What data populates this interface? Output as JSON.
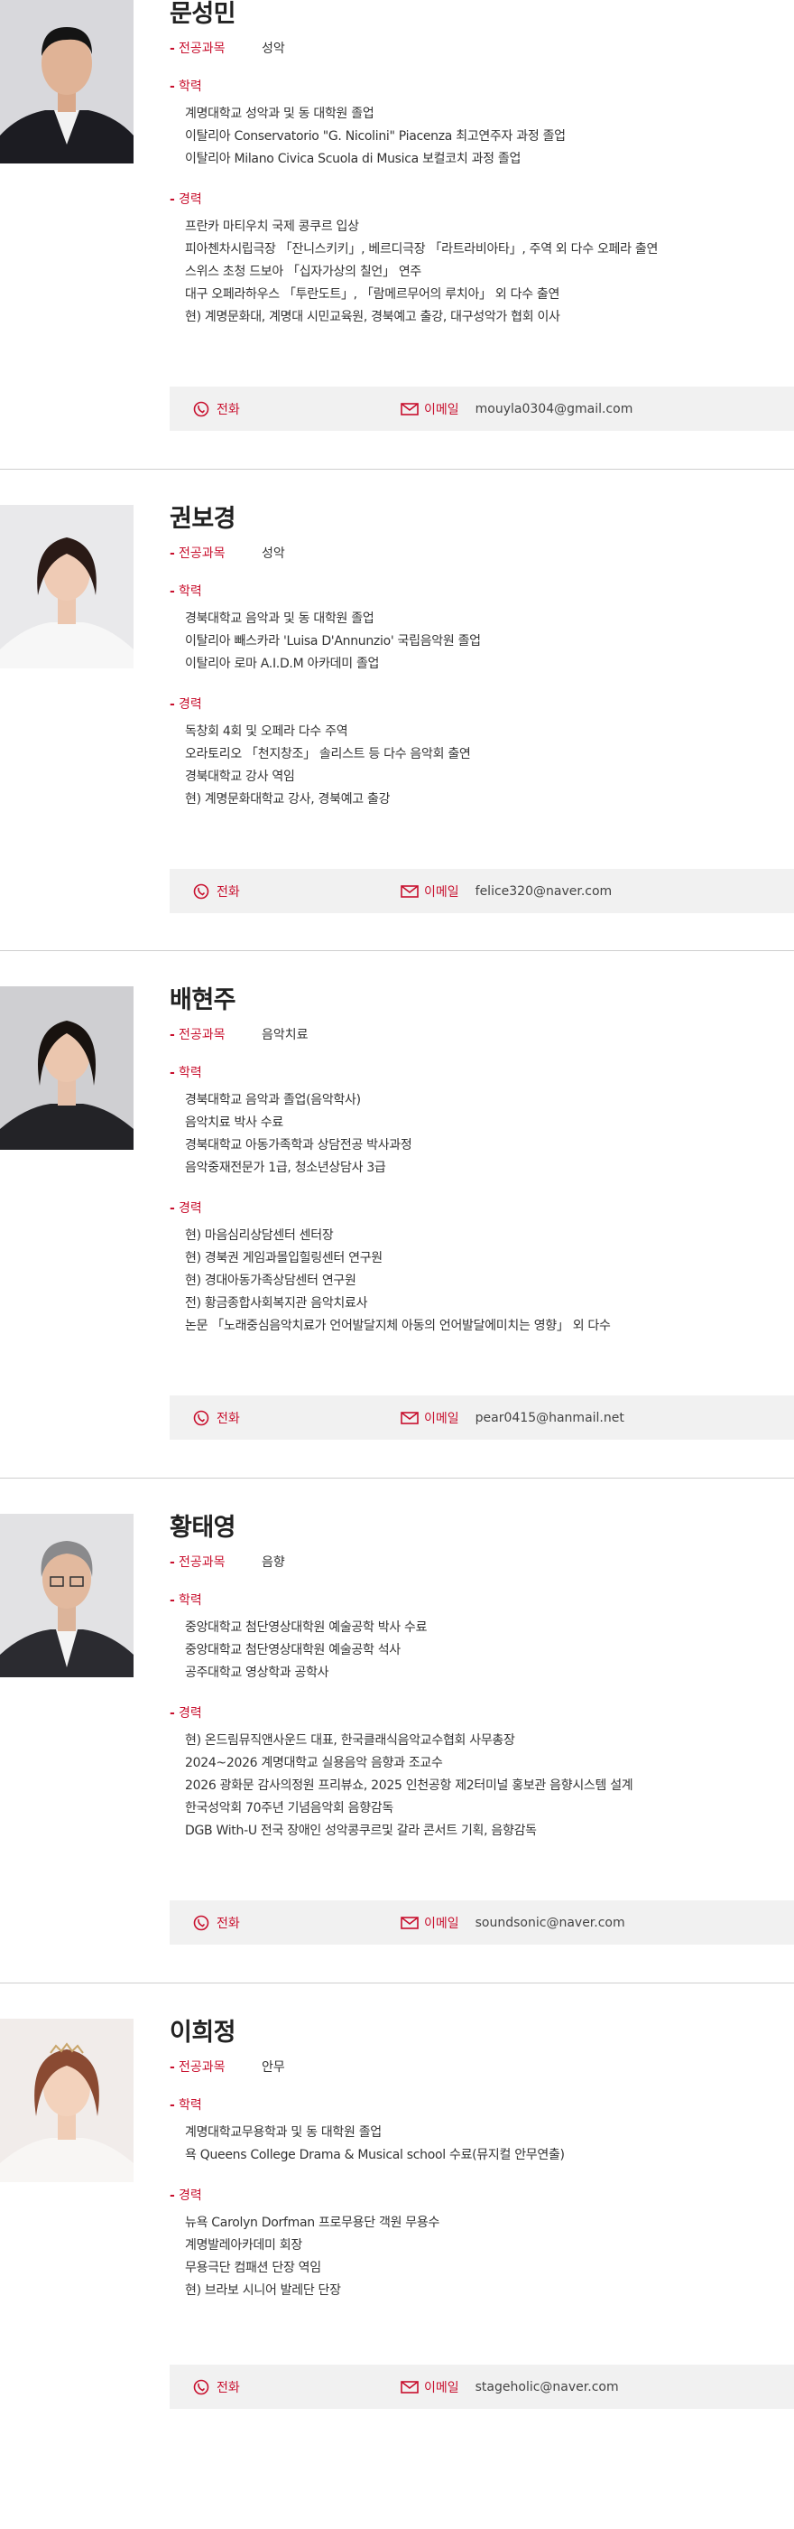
{
  "labels": {
    "major": "전공과목",
    "education": "학력",
    "career": "경력",
    "phone": "전화",
    "email": "이메일"
  },
  "profiles": [
    {
      "name": "문성민",
      "major": "성악",
      "education": [
        "계명대학교 성악과 및 동 대학원 졸업",
        "이탈리아 Conservatorio \"G. Nicolini\" Piacenza 최고연주자 과정 졸업",
        "이탈리아 Milano Civica Scuola di Musica 보컬코치 과정 졸업"
      ],
      "career": [
        "프란카 마티우치 국제 콩쿠르 입상",
        "피아첸차시립극장 「잔니스키키」, 베르디극장 「라트라비아타」, 주역 외 다수 오페라 출연",
        "스위스 초청 드보아 「십자가상의 칠언」 연주",
        "대구 오페라하우스 「투란도트」, 「람메르무어의 루치아」 외 다수 출연",
        "현) 계명문화대, 계명대 시민교육원, 경북예고 출강, 대구성악가 협회 이사"
      ],
      "email": "mouyla0304@gmail.com"
    },
    {
      "name": "권보경",
      "major": "성악",
      "education": [
        "경북대학교 음악과 및 동 대학원 졸업",
        "이탈리아 빼스카라 'Luisa D'Annunzio' 국립음악원 졸업",
        "이탈리아 로마 A.I.D.M 아카데미 졸업"
      ],
      "career": [
        "독창회 4회 및 오페라 다수 주역",
        "오라토리오 「천지창조」 솔리스트 등 다수 음악회 출연",
        "경북대학교 강사 역임",
        "현) 계명문화대학교 강사, 경북예고 출강"
      ],
      "email": "felice320@naver.com"
    },
    {
      "name": "배현주",
      "major": "음악치료",
      "education": [
        "경북대학교 음악과 졸업(음악학사)",
        "음악치료 박사 수료",
        "경북대학교 아동가족학과 상담전공 박사과정",
        "음악중재전문가 1급, 청소년상담사 3급"
      ],
      "career": [
        "현) 마음심리상담센터 센터장",
        "현) 경북권 게임과몰입힐링센터 연구원",
        "현) 경대아동가족상담센터 연구원",
        "전) 황금종합사회복지관 음악치료사",
        "논문 「노래중심음악치료가 언어발달지체 아동의 언어발달에미치는 영향」 외 다수"
      ],
      "email": "pear0415@hanmail.net"
    },
    {
      "name": "황태영",
      "major": "음향",
      "education": [
        "중앙대학교 첨단영상대학원 예술공학 박사 수료",
        "중앙대학교 첨단영상대학원 예술공학 석사",
        "공주대학교 영상학과 공학사"
      ],
      "career": [
        "현) 온드림뮤직앤사운드 대표, 한국클래식음악교수협회 사무총장",
        "2024~2026 계명대학교 실용음악 음향과 조교수",
        "2026 광화문 감사의정원 프리뷰쇼, 2025 인천공항 제2터미널 홍보관 음향시스템 설계",
        "한국성악회 70주년 기념음악회 음향감독",
        "DGB With-U 전국 장애인 성악콩쿠르및 갈라 콘서트 기획, 음향감독"
      ],
      "email": "soundsonic@naver.com"
    },
    {
      "name": "이희정",
      "major": "안무",
      "education": [
        "계명대학교무용학과 및 동 대학원 졸업",
        "욕 Queens College Drama & Musical school 수료(뮤지컬 안무연출)"
      ],
      "career": [
        "뉴욕 Carolyn Dorfman 프로무용단 객원 무용수",
        "계명발레아카데미 회장",
        "무용극단 컴패션 단장 역임",
        "현) 브라보 시니어 발레단 단장"
      ],
      "email": "stageholic@naver.com"
    }
  ]
}
